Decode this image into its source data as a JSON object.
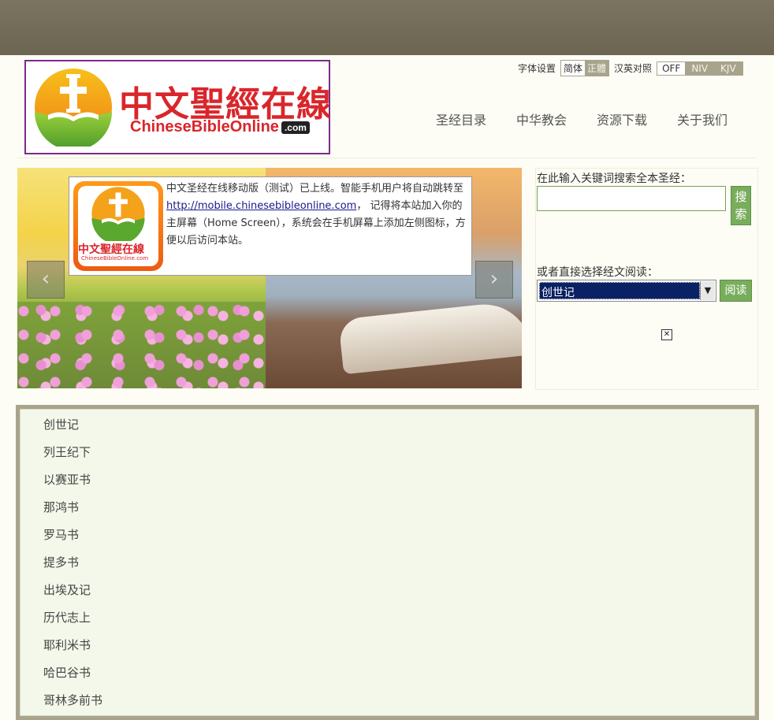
{
  "header": {
    "logo": {
      "cn_text": "中文聖經在線",
      "en_text": "ChineseBibleOnline",
      "en_suffix": ".com"
    },
    "settings": {
      "font_label": "字体设置",
      "font_options": [
        "简体",
        "正體"
      ],
      "font_selected": "简体",
      "compare_label": "汉英对照",
      "compare_options": [
        "OFF",
        "NIV",
        "KJV"
      ],
      "compare_selected": "OFF"
    },
    "nav": [
      "圣经目录",
      "中华教会",
      "资源下载",
      "关于我们"
    ]
  },
  "slider": {
    "notice_text_1": "中文圣经在线移动版（测试）已上线。智能手机用户将自动跳转至 ",
    "notice_link": "http://mobile.chinesebibleonline.com",
    "notice_text_2": "， 记得将本站加入你的主屏幕（Home Screen），系统会在手机屏幕上添加左侧图标，方便以后访问本站。",
    "app_icon_cn": "中文聖經在線",
    "app_icon_en": "ChineseBibleOnline.com",
    "prev_icon": "chevron-left-icon",
    "next_icon": "chevron-right-icon"
  },
  "search": {
    "label": "在此输入关键词搜索全本圣经：",
    "input_value": "",
    "button_label": "搜索",
    "read_label": "或者直接选择经文阅读：",
    "select_value": "创世记",
    "read_button": "阅读"
  },
  "book_list": [
    "创世记",
    "列王纪下",
    "以赛亚书",
    "那鸿书",
    "罗马书",
    "提多书",
    "出埃及记",
    "历代志上",
    "耶利米书",
    "哈巴谷书",
    "哥林多前书"
  ],
  "colors": {
    "topbar": "#6f6955",
    "logo_border": "#7b2b8c",
    "logo_red": "#d9262b",
    "button_green": "#78ad5c",
    "select_blue": "#0a2163",
    "list_border": "#a8a48c",
    "list_bg": "#f4f8ea"
  }
}
